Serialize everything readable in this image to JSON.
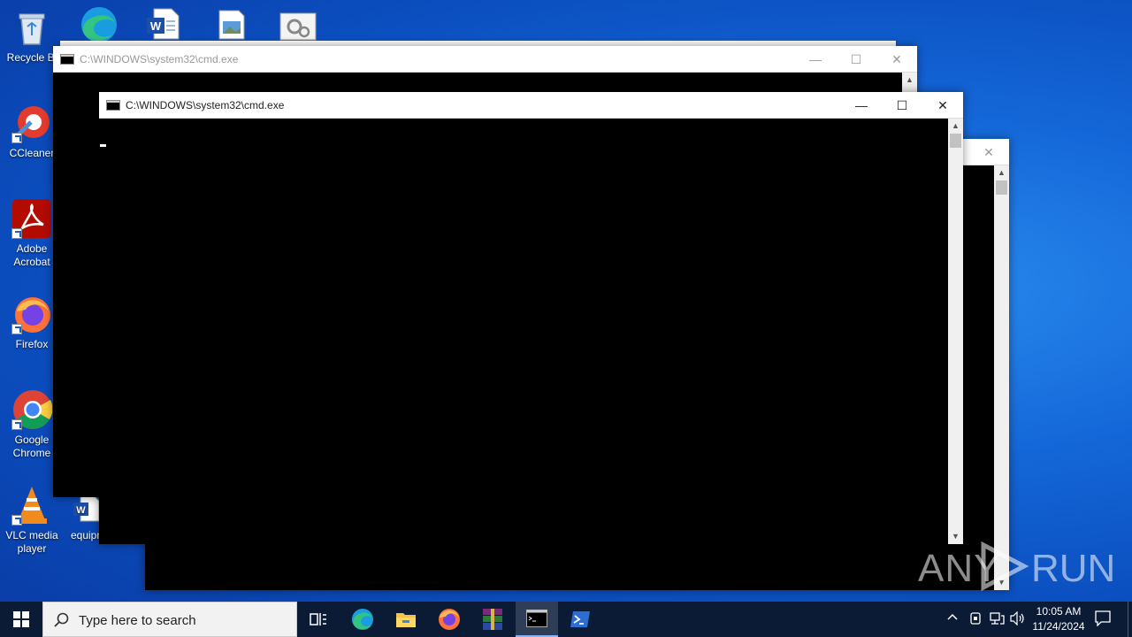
{
  "desktop": {
    "icons": [
      {
        "label": "Recycle Bi",
        "icon": "recycle-bin-icon"
      },
      {
        "label": "CCleaner",
        "icon": "ccleaner-icon"
      },
      {
        "label": "Adobe Acrobat",
        "icon": "adobe-acrobat-icon"
      },
      {
        "label": "Firefox",
        "icon": "firefox-icon"
      },
      {
        "label": "Google Chrome",
        "icon": "chrome-icon"
      },
      {
        "label": "VLC media player",
        "icon": "vlc-icon"
      },
      {
        "label": "equipn",
        "icon": "word-document-icon"
      }
    ],
    "top_row_icons": [
      "edge-icon",
      "word-document-icon",
      "image-file-icon",
      "settings-file-icon"
    ]
  },
  "windows": {
    "back_cmd": {
      "title": "C:\\WINDOWS\\system32\\cmd.exe"
    },
    "front_cmd": {
      "title": "C:\\WINDOWS\\system32\\cmd.exe"
    },
    "minimize": "—",
    "maximize": "☐",
    "close": "✕"
  },
  "taskbar": {
    "search_placeholder": "Type here to search",
    "apps": [
      "task-view-icon",
      "edge-icon",
      "file-explorer-icon",
      "firefox-icon",
      "winrar-icon",
      "cmd-icon",
      "powershell-icon"
    ],
    "active_app": "cmd-icon",
    "time": "10:05 AM",
    "date": "11/24/2024"
  },
  "watermark": {
    "text_left": "ANY",
    "text_right": "RUN"
  },
  "colors": {
    "taskbar": "#0c1b35",
    "desktop": "#1467d8",
    "console_bg": "#000000"
  }
}
